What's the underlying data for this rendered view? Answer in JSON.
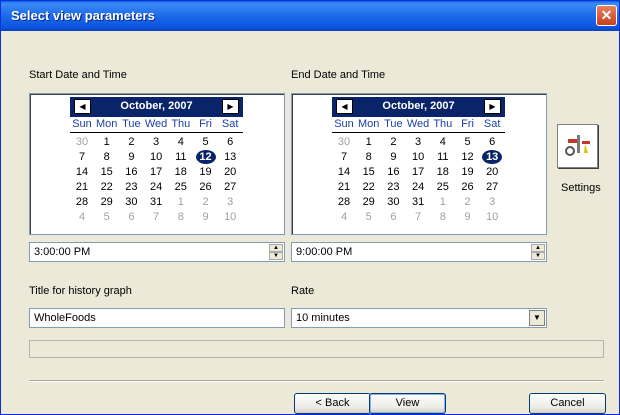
{
  "window": {
    "title": "Select view parameters"
  },
  "start": {
    "label": "Start Date and Time",
    "month_label": "October, 2007",
    "time": "3:00:00 PM",
    "selected_day": "12"
  },
  "end": {
    "label": "End Date and Time",
    "month_label": "October, 2007",
    "time": "9:00:00 PM",
    "selected_day": "13"
  },
  "weekdays": [
    "Sun",
    "Mon",
    "Tue",
    "Wed",
    "Thu",
    "Fri",
    "Sat"
  ],
  "calendar_weeks": [
    [
      "30",
      "1",
      "2",
      "3",
      "4",
      "5",
      "6"
    ],
    [
      "7",
      "8",
      "9",
      "10",
      "11",
      "12",
      "13"
    ],
    [
      "14",
      "15",
      "16",
      "17",
      "18",
      "19",
      "20"
    ],
    [
      "21",
      "22",
      "23",
      "24",
      "25",
      "26",
      "27"
    ],
    [
      "28",
      "29",
      "30",
      "31",
      "1",
      "2",
      "3"
    ],
    [
      "4",
      "5",
      "6",
      "7",
      "8",
      "9",
      "10"
    ]
  ],
  "settings": {
    "label": "Settings"
  },
  "history_title": {
    "label": "Title for history graph",
    "value": "WholeFoods"
  },
  "rate": {
    "label": "Rate",
    "value": "10 minutes"
  },
  "buttons": {
    "back": "< Back",
    "view": "View",
    "cancel": "Cancel"
  },
  "colors": {
    "title_bar": "#0a54dd",
    "calendar_header": "#0a246a",
    "weekday_text": "#1a3fa7",
    "dialog_bg": "#ece9d8"
  },
  "icons": {
    "settings": "tools-icon"
  }
}
